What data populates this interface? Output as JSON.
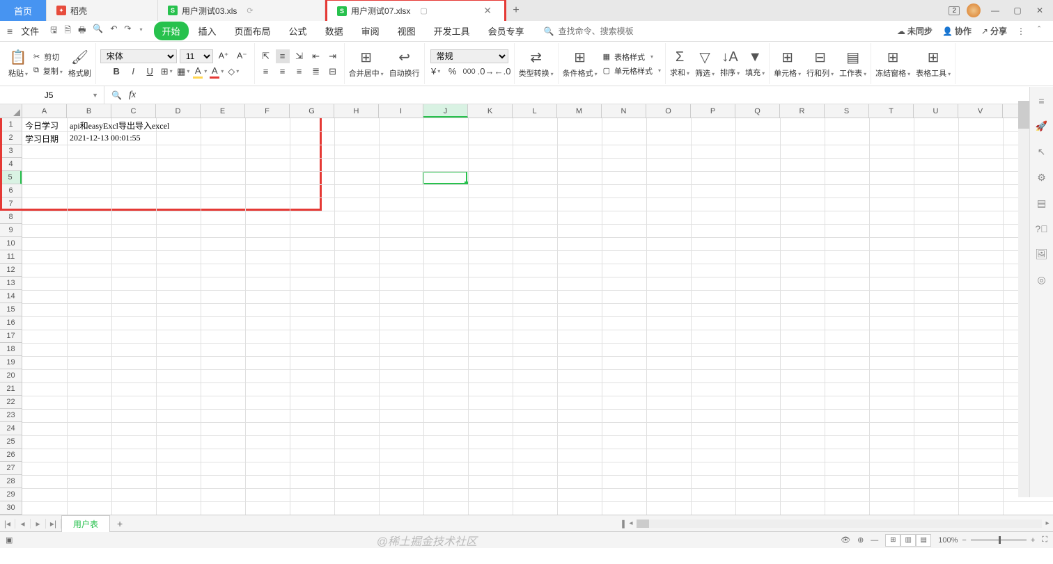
{
  "tabs": {
    "home": "首页",
    "daoke": "稻壳",
    "file1": "用户测试03.xls",
    "file2": "用户测试07.xlsx"
  },
  "titleRight": {
    "badge": "2"
  },
  "menu": {
    "file": "文件",
    "items": [
      "开始",
      "插入",
      "页面布局",
      "公式",
      "数据",
      "审阅",
      "视图",
      "开发工具",
      "会员专享"
    ],
    "searchPlaceholder": "查找命令、搜索模板",
    "unsync": "未同步",
    "collab": "协作",
    "share": "分享"
  },
  "ribbon": {
    "paste": "粘贴",
    "cut": "剪切",
    "copy": "复制",
    "fmtPaint": "格式刷",
    "font": "宋体",
    "fontSize": "11",
    "merge": "合并居中",
    "wrap": "自动换行",
    "numFmt": "常规",
    "typeConv": "类型转换",
    "condFmt": "条件格式",
    "tblStyle": "表格样式",
    "cellStyle": "单元格样式",
    "sum": "求和",
    "filter": "筛选",
    "sort": "排序",
    "fill": "填充",
    "cell": "单元格",
    "rowcol": "行和列",
    "sheet": "工作表",
    "freeze": "冻结窗格",
    "tblTool": "表格工具"
  },
  "nameBox": "J5",
  "columns": [
    "A",
    "B",
    "C",
    "D",
    "E",
    "F",
    "G",
    "H",
    "I",
    "J",
    "K",
    "L",
    "M",
    "N",
    "O",
    "P",
    "Q",
    "R",
    "S",
    "T",
    "U",
    "V"
  ],
  "selectedCol": "J",
  "selectedRow": 5,
  "cells": {
    "A1": "今日学习",
    "B1": "api和easyExcl导出导入excel",
    "A2": "学习日期",
    "B2": "2021-12-13 00:01:55"
  },
  "sheet": {
    "name": "用户表"
  },
  "status": {
    "zoom": "100%"
  },
  "watermark": "@稀土掘金技术社区"
}
